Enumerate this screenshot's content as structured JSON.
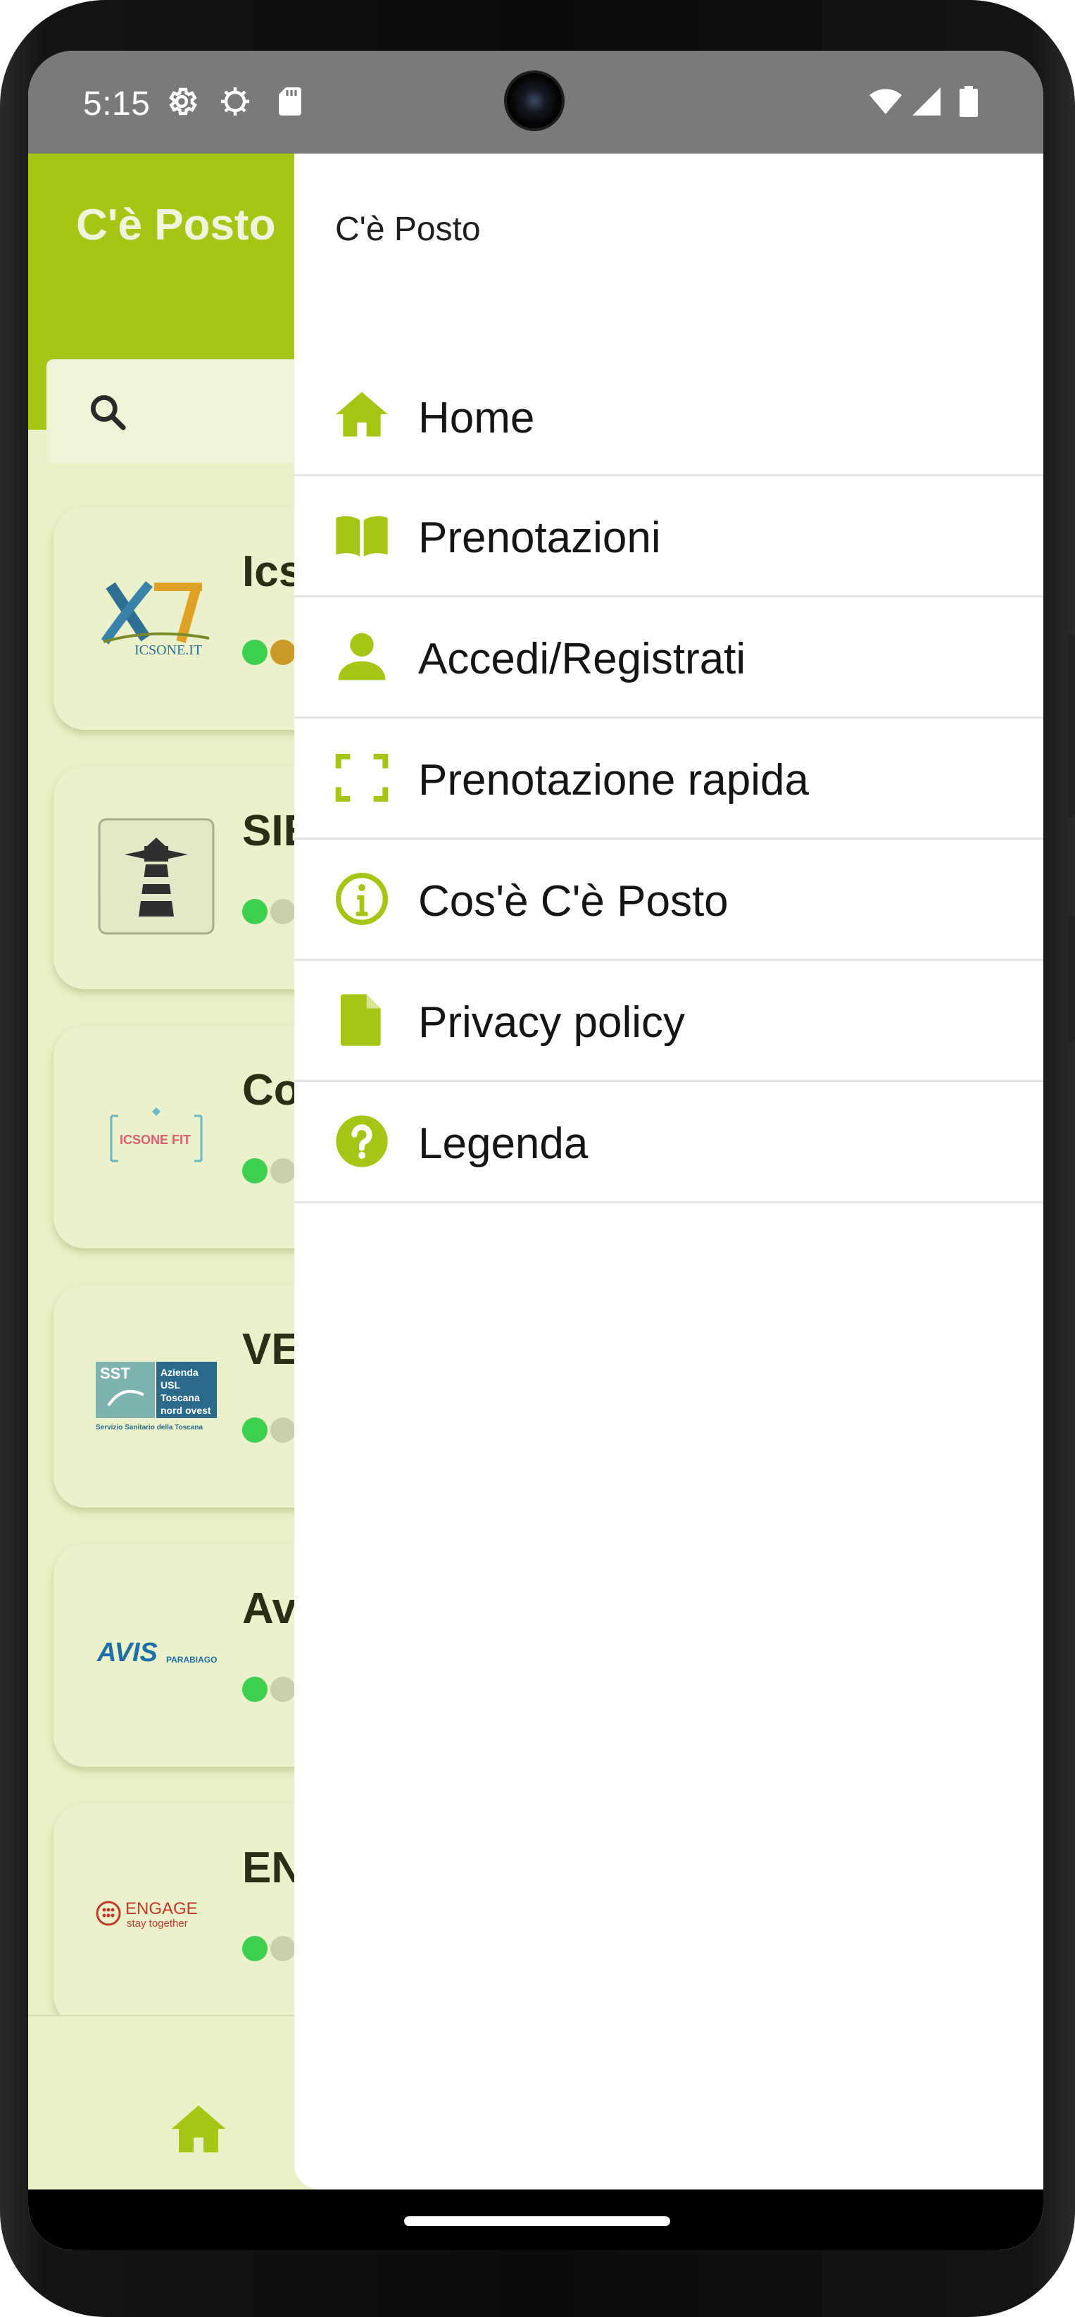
{
  "status_bar": {
    "time": "5:15"
  },
  "app": {
    "title": "C'è Posto",
    "search": {
      "placeholder": ""
    }
  },
  "list": [
    {
      "name": "Ics",
      "logo": "X1 ICSONE.IT",
      "dots": [
        "#3fcf4f",
        "#c99a28"
      ]
    },
    {
      "name": "SIE",
      "logo": "lighthouse-logo",
      "dots": [
        "#3fcf4f",
        "#c8d1aa"
      ]
    },
    {
      "name": "Co",
      "logo": "ICSONE FIT",
      "dots": [
        "#3fcf4f",
        "#c8d1aa"
      ]
    },
    {
      "name": "VE",
      "logo": "SST Azienda USL Toscana nord ovest",
      "dots": [
        "#3fcf4f",
        "#c8d1aa"
      ]
    },
    {
      "name": "Av",
      "logo": "AVIS PARABIAGO",
      "dots": [
        "#3fcf4f",
        "#c8d1aa"
      ]
    },
    {
      "name": "EN",
      "logo": "ENGAGE stay together",
      "dots": [
        "#3fcf4f",
        "#c8d1aa"
      ]
    }
  ],
  "drawer": {
    "header": "C'è Posto",
    "items": [
      {
        "label": "Home",
        "icon": "home-icon"
      },
      {
        "label": "Prenotazioni",
        "icon": "book-icon"
      },
      {
        "label": "Accedi/Registrati",
        "icon": "person-icon"
      },
      {
        "label": "Prenotazione rapida",
        "icon": "scan-frame-icon"
      },
      {
        "label": "Cos'è C'è Posto",
        "icon": "info-icon"
      },
      {
        "label": "Privacy policy",
        "icon": "document-icon"
      },
      {
        "label": "Legenda",
        "icon": "help-icon"
      }
    ]
  },
  "colors": {
    "accent": "#a6c616",
    "background": "#e9f1c6",
    "card": "#eaf1cb",
    "drawer": "#ffffff",
    "status_green": "#3fcf4f"
  }
}
